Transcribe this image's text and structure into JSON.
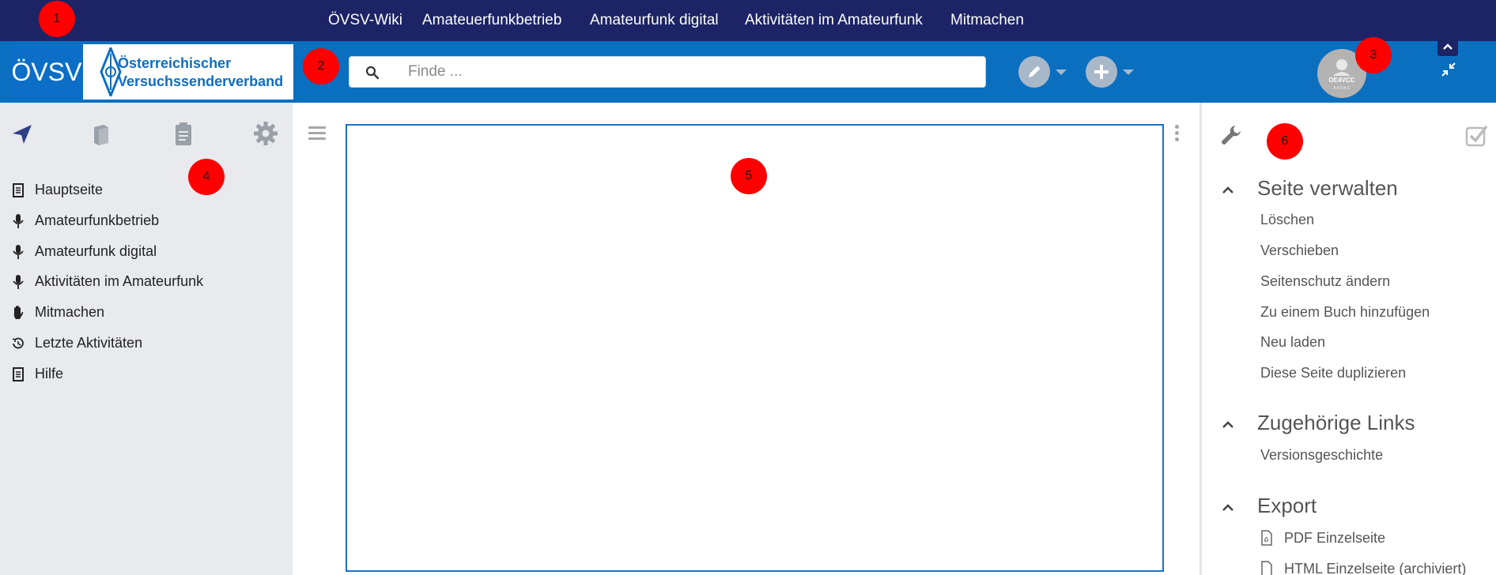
{
  "topnav": {
    "items": [
      "ÖVSV-Wiki",
      "Amateuerfunkbetrieb",
      "Amateurfunk digital",
      "Aktivitäten im Amateurfunk",
      "Mitmachen"
    ]
  },
  "header": {
    "logo": {
      "short": "ÖVSV",
      "line1": "Österreichischer",
      "line2": "Versuchssenderverband"
    },
    "search": {
      "placeholder": "Finde ...",
      "icon": "search-icon"
    },
    "edit_button_icon": "pencil-icon",
    "add_button_icon": "plus-icon",
    "avatar": {
      "callsign": "OE4VCC",
      "subtext": "ARPAS"
    },
    "colors": {
      "topnav_bg": "#1c2465",
      "header_bg": "#0b6fc0"
    }
  },
  "left_sidebar": {
    "tabs": [
      "navigation-icon",
      "book-icon",
      "clipboard-icon",
      "gear-icon"
    ],
    "items": [
      {
        "label": "Hauptseite",
        "icon": "document-icon"
      },
      {
        "label": "Amateurfunkbetrieb",
        "icon": "microphone-icon"
      },
      {
        "label": "Amateurfunk digital",
        "icon": "microphone-icon"
      },
      {
        "label": "Aktivitäten im Amateurfunk",
        "icon": "microphone-icon"
      },
      {
        "label": "Mitmachen",
        "icon": "hand-icon"
      },
      {
        "label": "Letzte Aktivitäten",
        "icon": "history-icon"
      },
      {
        "label": "Hilfe",
        "icon": "document-icon"
      }
    ]
  },
  "right_sidebar": {
    "sections": [
      {
        "title": "Seite verwalten",
        "links": [
          "Löschen",
          "Verschieben",
          "Seitenschutz ändern",
          "Zu einem Buch hinzufügen",
          "Neu laden",
          "Diese Seite duplizieren"
        ]
      },
      {
        "title": "Zugehörige Links",
        "links": [
          "Versionsgeschichte"
        ]
      },
      {
        "title": "Export",
        "links": [
          "PDF Einzelseite",
          "HTML Einzelseite (archiviert)"
        ]
      }
    ]
  },
  "markers": [
    "1",
    "2",
    "3",
    "4",
    "5",
    "6"
  ]
}
